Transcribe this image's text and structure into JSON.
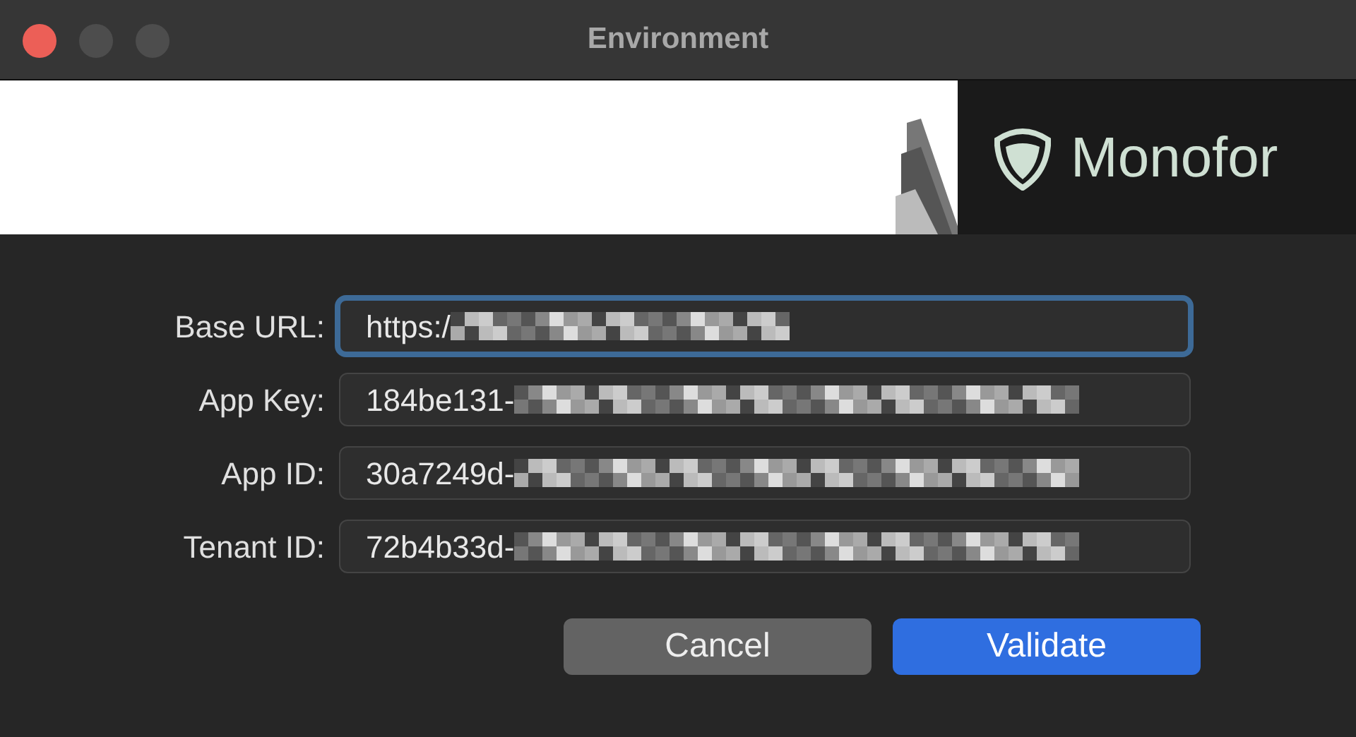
{
  "window": {
    "title": "Environment",
    "traffic_lights": [
      {
        "color": "#ec5f57"
      },
      {
        "color": "#4d4d4d"
      },
      {
        "color": "#4d4d4d"
      }
    ]
  },
  "banner": {
    "brand": "Monofor"
  },
  "fields": [
    {
      "label": "Base URL:",
      "value": "https:/",
      "focused": true
    },
    {
      "label": "App Key:",
      "value": "184be131-",
      "focused": false
    },
    {
      "label": "App ID:",
      "value": "30a7249d-",
      "focused": false
    },
    {
      "label": "Tenant ID:",
      "value": "72b4b33d-",
      "focused": false
    }
  ],
  "buttons": [
    {
      "label": "Cancel",
      "primary": false
    },
    {
      "label": "Validate",
      "primary": true
    }
  ]
}
